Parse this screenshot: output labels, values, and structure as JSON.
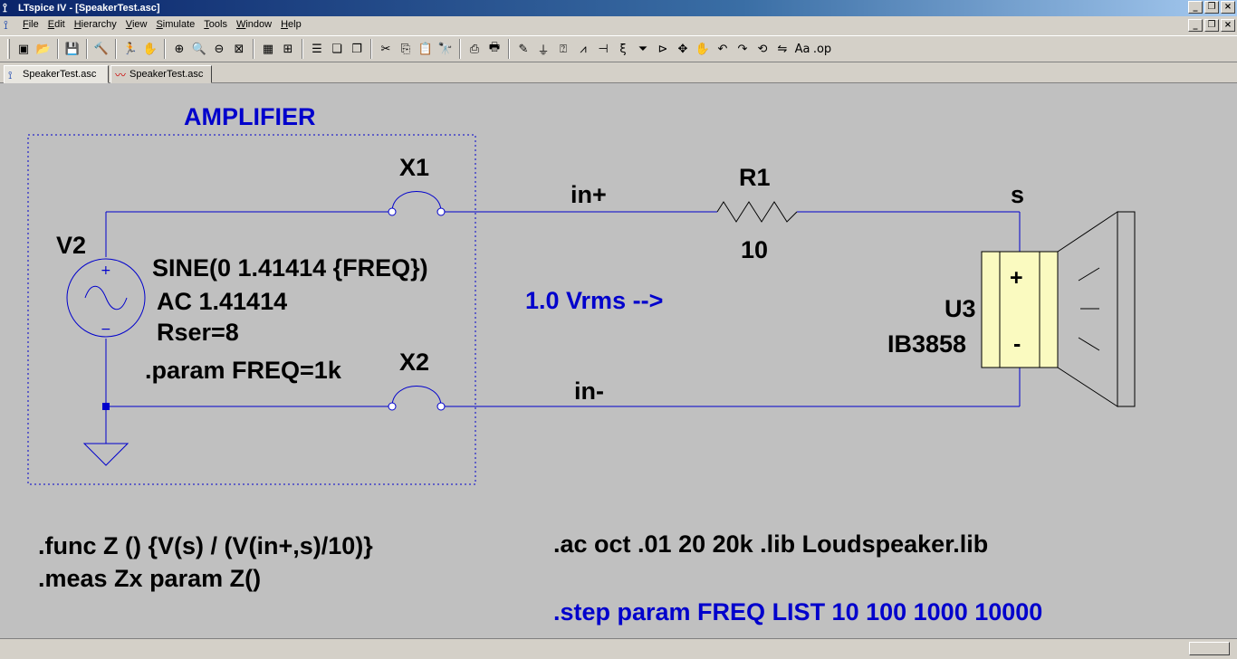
{
  "window": {
    "title": "LTspice IV - [SpeakerTest.asc]",
    "buttons": {
      "minimize": "_",
      "restore": "❐",
      "close": "×"
    }
  },
  "menubar": {
    "items": [
      {
        "label": "File",
        "underline": "F"
      },
      {
        "label": "Edit",
        "underline": "E"
      },
      {
        "label": "Hierarchy",
        "underline": "H"
      },
      {
        "label": "View",
        "underline": "V"
      },
      {
        "label": "Simulate",
        "underline": "S"
      },
      {
        "label": "Tools",
        "underline": "T"
      },
      {
        "label": "Window",
        "underline": "W"
      },
      {
        "label": "Help",
        "underline": "H"
      }
    ]
  },
  "toolbar": {
    "groups": [
      [
        {
          "icon": "new-schematic-icon",
          "glyph": "▣"
        },
        {
          "icon": "open-folder-icon",
          "glyph": "📂"
        }
      ],
      [
        {
          "icon": "save-icon",
          "glyph": "💾"
        }
      ],
      [
        {
          "icon": "control-panel-icon",
          "glyph": "🔨"
        }
      ],
      [
        {
          "icon": "run-icon",
          "glyph": "🏃"
        },
        {
          "icon": "halt-icon",
          "glyph": "✋"
        }
      ],
      [
        {
          "icon": "zoom-in-icon",
          "glyph": "⊕"
        },
        {
          "icon": "pan-icon",
          "glyph": "🔍"
        },
        {
          "icon": "zoom-out-icon",
          "glyph": "⊖"
        },
        {
          "icon": "zoom-fit-icon",
          "glyph": "⊠"
        }
      ],
      [
        {
          "icon": "autorange-icon",
          "glyph": "▦"
        },
        {
          "icon": "grid-icon",
          "glyph": "⊞"
        }
      ],
      [
        {
          "icon": "tile-horizontal-icon",
          "glyph": "☰"
        },
        {
          "icon": "cascade-icon",
          "glyph": "❏"
        },
        {
          "icon": "tile-vertical-icon",
          "glyph": "❐"
        }
      ],
      [
        {
          "icon": "cut-icon",
          "glyph": "✂"
        },
        {
          "icon": "copy-icon",
          "glyph": "⎘"
        },
        {
          "icon": "paste-icon",
          "glyph": "📋"
        },
        {
          "icon": "find-icon",
          "glyph": "🔭"
        }
      ],
      [
        {
          "icon": "print-setup-icon",
          "glyph": "⎙"
        },
        {
          "icon": "print-icon",
          "glyph": "🖶"
        }
      ],
      [
        {
          "icon": "draw-wire-icon",
          "glyph": "✎"
        },
        {
          "icon": "ground-icon",
          "glyph": "⏚"
        },
        {
          "icon": "label-net-icon",
          "glyph": "⍰"
        },
        {
          "icon": "resistor-icon",
          "glyph": "⩘"
        },
        {
          "icon": "capacitor-icon",
          "glyph": "⊣"
        },
        {
          "icon": "inductor-icon",
          "glyph": "ξ"
        },
        {
          "icon": "diode-icon",
          "glyph": "⏷"
        },
        {
          "icon": "component-icon",
          "glyph": "⊳"
        },
        {
          "icon": "move-icon",
          "glyph": "✥"
        },
        {
          "icon": "drag-icon",
          "glyph": "✋"
        },
        {
          "icon": "undo-icon",
          "glyph": "↶"
        },
        {
          "icon": "redo-icon",
          "glyph": "↷"
        },
        {
          "icon": "rotate-icon",
          "glyph": "⟲"
        },
        {
          "icon": "mirror-icon",
          "glyph": "⇋"
        },
        {
          "icon": "text-icon",
          "glyph": "Aa"
        },
        {
          "icon": "spice-directive-icon",
          "glyph": ".op"
        }
      ]
    ]
  },
  "tabs": [
    {
      "label": "SpeakerTest.asc",
      "icon": "schematic-icon",
      "active": true
    },
    {
      "label": "SpeakerTest.asc",
      "icon": "waveform-icon",
      "active": false
    }
  ],
  "schematic": {
    "colors": {
      "wire": "#0000cc",
      "text": "#000000",
      "comment": "#0000cc",
      "speaker_fill": "#fafac0",
      "background": "#c0c0c0"
    },
    "amplifier_label": "AMPLIFIER",
    "components": {
      "X1": "X1",
      "X2": "X2",
      "R1_name": "R1",
      "R1_value": "10",
      "V2_name": "V2",
      "V2_value1": "SINE(0 1.41414 {FREQ})",
      "V2_value2": "AC 1.41414",
      "V2_value3": "Rser=8",
      "U3_name": "U3",
      "U3_value": "IB3858",
      "plus": "+",
      "minus": "-",
      "v_plus": "+",
      "v_minus": "−"
    },
    "nets": {
      "in_plus": "in+",
      "in_minus": "in-",
      "s": "s"
    },
    "directives": {
      "param": ".param FREQ=1k",
      "func": ".func Z () {V(s) / (V(in+,s)/10)}",
      "meas": ".meas Zx param Z()",
      "ac_lib": ".ac oct .01 20 20k  .lib Loudspeaker.lib",
      "step": ".step param FREQ LIST 10 100 1000 10000"
    },
    "comment": "1.0 Vrms -->"
  }
}
